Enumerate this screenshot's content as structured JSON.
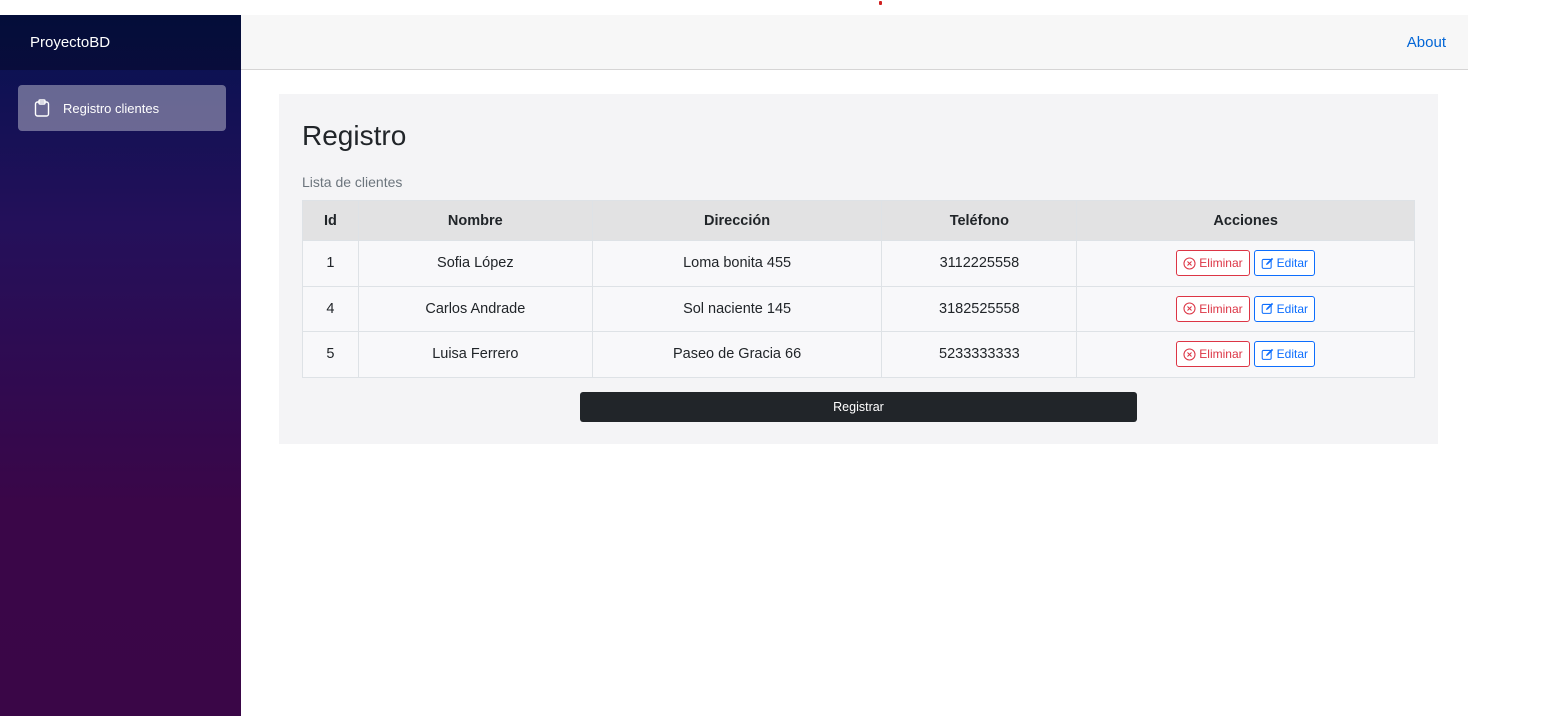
{
  "sidebar": {
    "brand": "ProyectoBD",
    "items": [
      {
        "label": "Registro clientes",
        "icon": "clipboard-icon"
      }
    ]
  },
  "topbar": {
    "about_label": "About"
  },
  "main": {
    "title": "Registro",
    "caption": "Lista de clientes",
    "table": {
      "headers": [
        "Id",
        "Nombre",
        "Dirección",
        "Teléfono",
        "Acciones"
      ],
      "rows": [
        {
          "id": "1",
          "nombre": "Sofia López",
          "direccion": "Loma bonita 455",
          "telefono": "3112225558"
        },
        {
          "id": "4",
          "nombre": "Carlos Andrade",
          "direccion": "Sol naciente 145",
          "telefono": "3182525558"
        },
        {
          "id": "5",
          "nombre": "Luisa Ferrero",
          "direccion": "Paseo de Gracia 66",
          "telefono": "5233333333"
        }
      ],
      "actions": {
        "delete_label": "Eliminar",
        "edit_label": "Editar"
      }
    },
    "register_label": "Registrar"
  },
  "colors": {
    "danger": "#dc3545",
    "primary": "#0d6efd",
    "dark": "#212529",
    "link": "#0366d6"
  }
}
